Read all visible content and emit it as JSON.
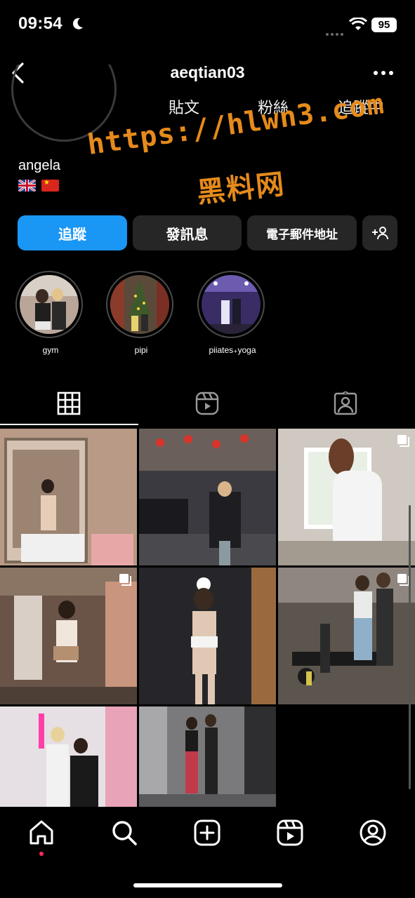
{
  "status_bar": {
    "time": "09:54",
    "battery": "95"
  },
  "header": {
    "username": "aeqtian03"
  },
  "profile": {
    "stats": {
      "posts_label": "貼文",
      "followers_label": "粉絲",
      "following_label": "追蹤中"
    },
    "display_name": "angela"
  },
  "watermark": {
    "url": "https://hlwn3.com",
    "name": "黑料网"
  },
  "buttons": {
    "follow": "追蹤",
    "message": "發訊息",
    "email": "電子郵件地址"
  },
  "highlights": [
    {
      "label": "gym"
    },
    {
      "label": "pipi"
    },
    {
      "label": "piiates₊yoga"
    }
  ],
  "colors": {
    "accent": "#1a96f5",
    "watermark": "#e58a1b",
    "background": "#000000"
  },
  "icons": {
    "tabs": [
      "grid-icon",
      "reels-icon",
      "tagged-icon"
    ],
    "nav": [
      "home-icon",
      "search-icon",
      "create-icon",
      "reels-icon",
      "profile-icon"
    ]
  }
}
